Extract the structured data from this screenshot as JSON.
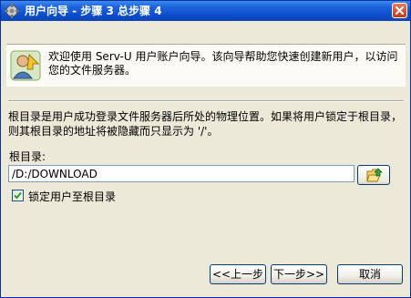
{
  "window": {
    "title": "用户向导 - 步骤 3 总步骤 4",
    "close_icon": "close-icon"
  },
  "banner": {
    "icon": "wizard-user-icon",
    "text": "欢迎使用 Serv-U 用户账户向导。该向导帮助您快速创建新用户，以访问您的文件服务器。"
  },
  "description": "根目录是用户成功登录文件服务器后所处的物理位置。如果将用户锁定于根目录，则其根目录的地址将被隐藏而只显示为 '/'。",
  "root_dir": {
    "label": "根目录:",
    "value": "/D:/DOWNLOAD",
    "browse_icon": "folder-open-icon"
  },
  "lock": {
    "label": "锁定用户至根目录",
    "checked": true
  },
  "buttons": {
    "back": "<<上一步",
    "next": "下一步>>",
    "cancel": "取消"
  },
  "colors": {
    "titlebar": "#0d4ecb",
    "dialog_bg": "#ece9d8",
    "banner_bg": "#fbfaf4"
  }
}
